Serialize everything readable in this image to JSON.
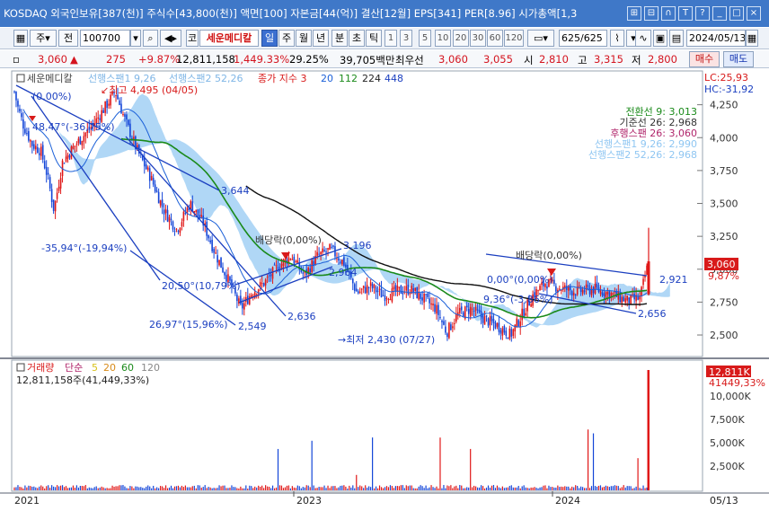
{
  "titlebar": {
    "title": "KOSDAQ 외국인보유[387(천)] 주식수[43,800(천)] 액면[100] 자본금[44(억)] 결산[12월] EPS[341] PER[8.96] 시가총액[1,3",
    "buttons": [
      "⊞",
      "⊟",
      "∩",
      "T",
      "?",
      "_",
      "□",
      "×"
    ]
  },
  "toolbar": {
    "type_label": "주",
    "prev_label": "전",
    "stock_code": "100700",
    "code_prefix": "코",
    "stock_name": "세운메디칼",
    "periods": [
      "일",
      "주",
      "월",
      "년",
      "분",
      "초",
      "틱"
    ],
    "intervals": [
      "1",
      "3",
      "5",
      "10",
      "20",
      "30",
      "60",
      "120"
    ],
    "page_count": "625/625",
    "date": "2024/05/13"
  },
  "quote": {
    "price": "3,060",
    "price_arrow": "▲",
    "change": "275",
    "change_pct": "+9.87%",
    "volume": "12,811,158",
    "volume_ratio": "1,449.33%",
    "turnover": "29.25%",
    "amount": "39,705백만",
    "best_bid_label": "최우선",
    "best_ask": "3,060",
    "best_bid": "3,055",
    "open_label": "시",
    "open": "2,810",
    "high_label": "고",
    "high": "3,315",
    "low_label": "저",
    "low": "2,800",
    "buy_label": "매수",
    "sell_label": "매도"
  },
  "chart_legend": {
    "stock_name": "세운메디칼",
    "span1": "선행스팬1 9,26",
    "span2": "선행스팬2 52,26",
    "ma_label": "종가 지수 3",
    "ma_periods": [
      "20",
      "112",
      "224",
      "448"
    ],
    "lc": "LC:25,93",
    "hc": "HC:-31,92",
    "ichimoku": [
      "전환선 9: 3,013",
      "기준선 26: 2,968",
      "후행스팬 26: 3,060",
      "선행스팬1 9,26: 2,990",
      "선행스팬2 52,26: 2,968"
    ]
  },
  "annotations": {
    "high": "최고 4,495 (04/05)",
    "low": "최저 2,430 (07/27)",
    "zero_pct": "(0.00%)",
    "pct_1": "48,47°(-36,75%)",
    "pct_2": "-35,94°(-19,94%)",
    "pct_3": "20,50°(10,79%)",
    "pct_4": "26,97°(15,96%)",
    "pct_5": "0,00°(0,00%)",
    "pct_6": "9,36°(-3,86%)",
    "dividend_1": "배당락(0,00%)",
    "dividend_2": "배당락(0,00%)",
    "v_3644": "3,644",
    "v_3196": "3,196",
    "v_2964": "2,964",
    "v_2636": "2,636",
    "v_2549": "2,549",
    "v_2921": "2,921",
    "v_2656": "2,656",
    "price_tag": "3,060",
    "pct_tag": "9,87%"
  },
  "volume_panel": {
    "label": "거래량",
    "ma_label": "단순",
    "ma_periods": [
      "5",
      "20",
      "60",
      "120"
    ],
    "value_text": "12,811,158주(41,449,33%)",
    "tag_value": "12,811K",
    "tag_pct": "41449,33%"
  },
  "x_axis": [
    "2021",
    "2023",
    "2024",
    "05/13"
  ],
  "chart_data": {
    "type": "candlestick",
    "price_axis": [
      4250,
      4000,
      3750,
      3500,
      3250,
      3000,
      2750,
      2500
    ],
    "volume_axis": [
      "10,000K",
      "7,500K",
      "5,000K",
      "2,500K"
    ],
    "ylim": [
      2350,
      4500
    ],
    "last_close": 3060,
    "period_high": 4495,
    "period_low": 2430,
    "ma_colors": {
      "ma20": "#1b60d8",
      "ma112": "#1a8a1a",
      "ma224": "#111111",
      "span_cloud": "#8fc6f2"
    },
    "up_color": "#e01818",
    "down_color": "#1446d8"
  }
}
